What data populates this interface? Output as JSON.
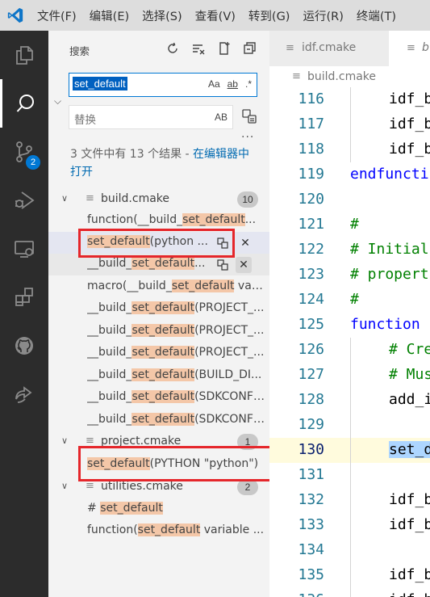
{
  "menu": [
    "文件(F)",
    "编辑(E)",
    "选择(S)",
    "查看(V)",
    "转到(G)",
    "运行(R)",
    "终端(T)"
  ],
  "activity": {
    "scm_badge": "2"
  },
  "sidebar": {
    "title": "搜索",
    "search_value": "set_default",
    "search_opts": [
      "Aa",
      "ab",
      ".*"
    ],
    "replace_placeholder": "替换",
    "replace_ab": "AB",
    "more": "···",
    "summary_prefix": "3 文件中有 13 个结果 - ",
    "summary_link": "在编辑器中打开"
  },
  "results": {
    "files": [
      {
        "name": "build.cmake",
        "count": "10"
      },
      {
        "name": "project.cmake",
        "count": "1"
      },
      {
        "name": "utilities.cmake",
        "count": "2"
      }
    ],
    "matches": [
      {
        "pre": "function(__build_",
        "hl": "set_default",
        "post": "..."
      },
      {
        "pre": "",
        "hl": "set_default",
        "post": "(python ..."
      },
      {
        "pre": "__build_",
        "hl": "set_default",
        "post": "..."
      },
      {
        "pre": "macro(__build_",
        "hl": "set_default",
        "post": " variable..."
      },
      {
        "pre": "__build_",
        "hl": "set_default",
        "post": "(PROJECT_..."
      },
      {
        "pre": "__build_",
        "hl": "set_default",
        "post": "(PROJECT_..."
      },
      {
        "pre": "__build_",
        "hl": "set_default",
        "post": "(PROJECT_..."
      },
      {
        "pre": "__build_",
        "hl": "set_default",
        "post": "(BUILD_DI..."
      },
      {
        "pre": "__build_",
        "hl": "set_default",
        "post": "(SDKCONFI..."
      },
      {
        "pre": "__build_",
        "hl": "set_default",
        "post": "(SDKCONFI..."
      },
      {
        "pre": "",
        "hl": "set_default",
        "post": "(PYTHON \"python\")"
      },
      {
        "pre": "# ",
        "hl": "set_default",
        "post": ""
      },
      {
        "pre": "function(",
        "hl": "set_default",
        "post": " variable ..."
      }
    ]
  },
  "editor": {
    "tabs": [
      {
        "label": "idf.cmake"
      },
      {
        "label": "b"
      }
    ],
    "breadcrumb": "build.cmake",
    "lines": [
      {
        "n": "116",
        "t": "idf_b",
        "cls": ""
      },
      {
        "n": "117",
        "t": "idf_b",
        "cls": ""
      },
      {
        "n": "118",
        "t": "idf_b",
        "cls": ""
      },
      {
        "n": "119",
        "t": "endfuncti",
        "cls": "kw"
      },
      {
        "n": "120",
        "t": "",
        "cls": ""
      },
      {
        "n": "121",
        "t": "#",
        "cls": "cm"
      },
      {
        "n": "122",
        "t": "# Initial",
        "cls": "cm"
      },
      {
        "n": "123",
        "t": "# propert",
        "cls": "cm"
      },
      {
        "n": "124",
        "t": "#",
        "cls": "cm"
      },
      {
        "n": "125",
        "t": "function",
        "cls": "kw"
      },
      {
        "n": "126",
        "t": "# Cre",
        "cls": "cm"
      },
      {
        "n": "127",
        "t": "# Mus",
        "cls": "cm"
      },
      {
        "n": "128",
        "t": "add_i",
        "cls": ""
      },
      {
        "n": "129",
        "t": "",
        "cls": ""
      },
      {
        "n": "130",
        "t": "set_d",
        "cls": "sel"
      },
      {
        "n": "131",
        "t": "",
        "cls": ""
      },
      {
        "n": "132",
        "t": "idf_b",
        "cls": ""
      },
      {
        "n": "133",
        "t": "idf_b",
        "cls": ""
      },
      {
        "n": "134",
        "t": "",
        "cls": ""
      },
      {
        "n": "135",
        "t": "idf_b",
        "cls": ""
      },
      {
        "n": "136",
        "t": "idf_b",
        "cls": ""
      }
    ]
  }
}
